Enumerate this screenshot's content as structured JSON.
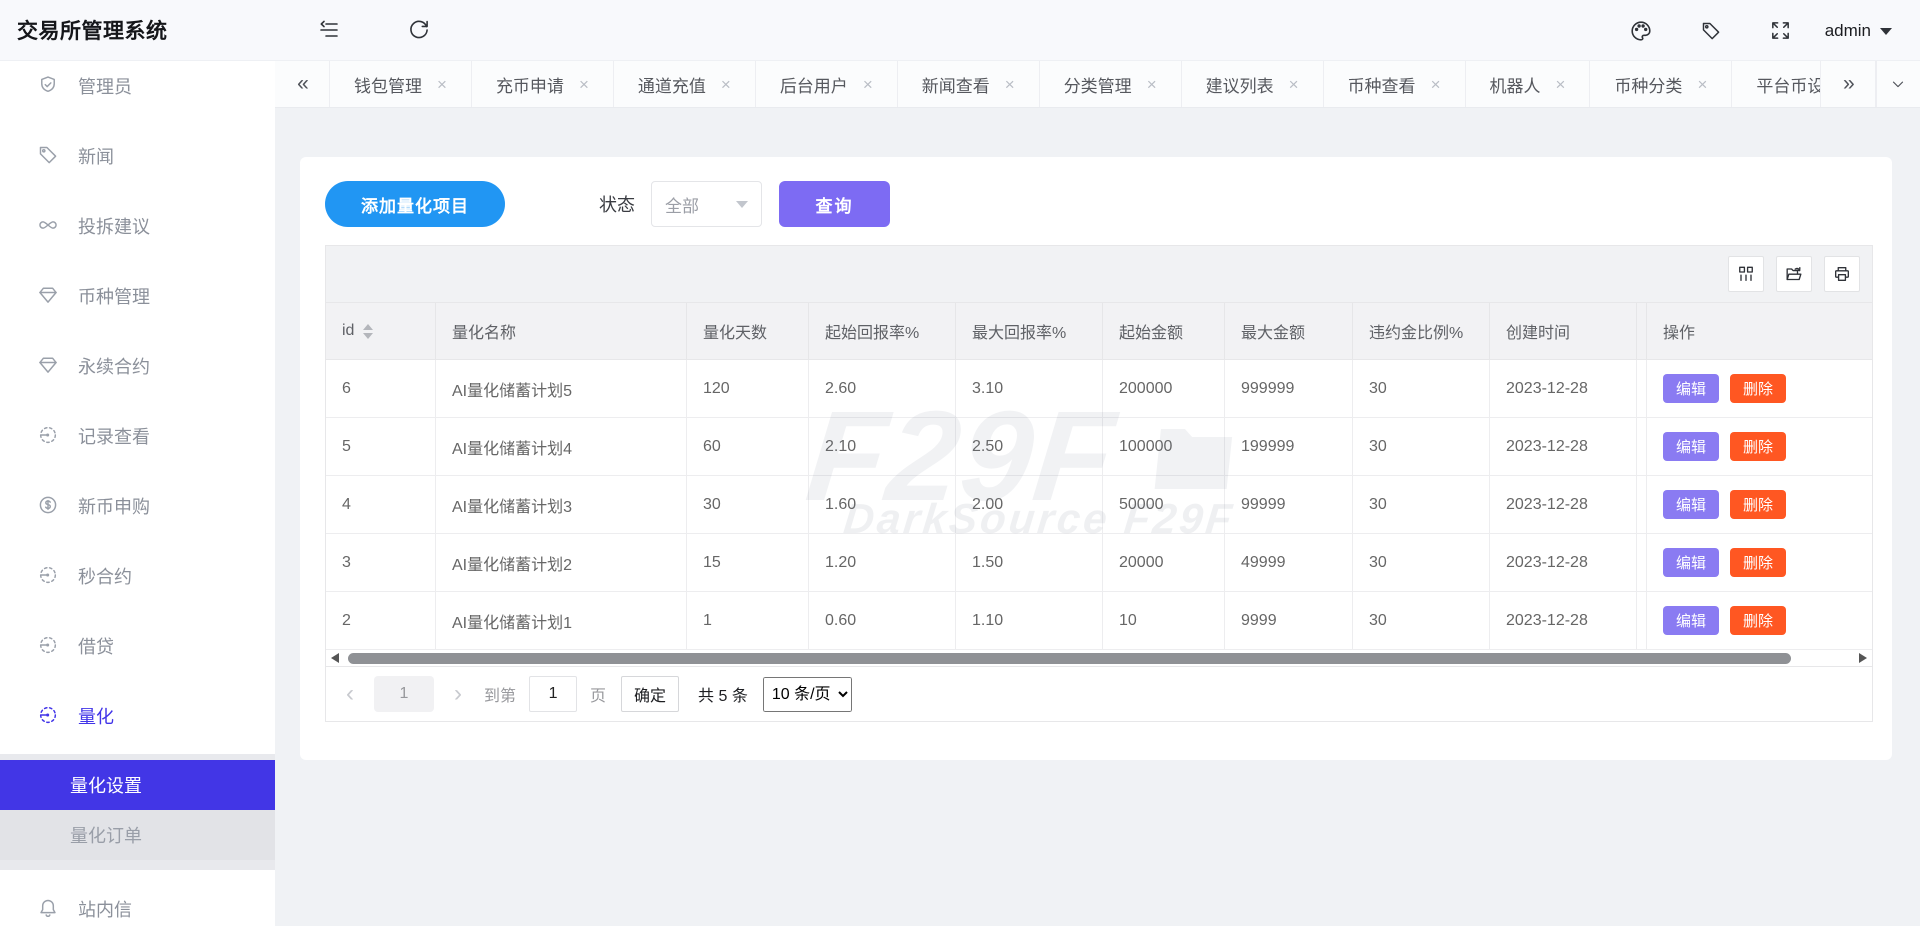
{
  "colors": {
    "accent_blue": "#2196f3",
    "accent_purple": "#7d6bf3",
    "edit_purple": "#8a7bf2",
    "delete_orange": "#ff5722",
    "active_indigo": "#4236e6",
    "page_background": "#f0f2f5"
  },
  "header": {
    "brand": "交易所管理系统",
    "user": "admin"
  },
  "sidebar": {
    "items": [
      {
        "label": "管理员",
        "icon": "shield-check"
      },
      {
        "label": "新闻",
        "icon": "tag"
      },
      {
        "label": "投拆建议",
        "icon": "infinity"
      },
      {
        "label": "币种管理",
        "icon": "diamond"
      },
      {
        "label": "永续合约",
        "icon": "diamond"
      },
      {
        "label": "记录查看",
        "icon": "gauge"
      },
      {
        "label": "新币申购",
        "icon": "dollar-circle"
      },
      {
        "label": "秒合约",
        "icon": "gauge"
      },
      {
        "label": "借贷",
        "icon": "gauge"
      },
      {
        "label": "量化",
        "icon": "gauge",
        "active": true
      },
      {
        "label": "站内信",
        "icon": "bell"
      }
    ],
    "submenu": [
      {
        "label": "量化设置",
        "active": true
      },
      {
        "label": "量化订单"
      }
    ]
  },
  "tabs": {
    "items": [
      {
        "label": "钱包管理"
      },
      {
        "label": "充币申请"
      },
      {
        "label": "通道充值"
      },
      {
        "label": "后台用户"
      },
      {
        "label": "新闻查看"
      },
      {
        "label": "分类管理"
      },
      {
        "label": "建议列表"
      },
      {
        "label": "币种查看"
      },
      {
        "label": "机器人"
      },
      {
        "label": "币种分类"
      },
      {
        "label": "平台币设",
        "truncated": true
      }
    ]
  },
  "glyphs": {
    "scroll_left": "«",
    "scroll_right": "»",
    "close": "×",
    "prev": "‹",
    "next": "›"
  },
  "filters": {
    "add_button": "添加量化项目",
    "status_label": "状态",
    "status_value": "全部",
    "search_button": "查询"
  },
  "table": {
    "columns": [
      "id",
      "量化名称",
      "量化天数",
      "起始回报率%",
      "最大回报率%",
      "起始金额",
      "最大金额",
      "违约金比例%",
      "创建时间",
      "操作"
    ],
    "rows": [
      [
        "6",
        "AI量化储蓄计划5",
        "120",
        "2.60",
        "3.10",
        "200000",
        "999999",
        "30",
        "2023-12-28"
      ],
      [
        "5",
        "AI量化储蓄计划4",
        "60",
        "2.10",
        "2.50",
        "100000",
        "199999",
        "30",
        "2023-12-28"
      ],
      [
        "4",
        "AI量化储蓄计划3",
        "30",
        "1.60",
        "2.00",
        "50000",
        "99999",
        "30",
        "2023-12-28"
      ],
      [
        "3",
        "AI量化储蓄计划2",
        "15",
        "1.20",
        "1.50",
        "20000",
        "49999",
        "30",
        "2023-12-28"
      ],
      [
        "2",
        "AI量化储蓄计划1",
        "1",
        "0.60",
        "1.10",
        "10",
        "9999",
        "30",
        "2023-12-28"
      ]
    ],
    "edit_label": "编辑",
    "delete_label": "删除"
  },
  "pagination": {
    "current": "1",
    "goto_prefix": "到第",
    "goto_value": "1",
    "goto_suffix": "页",
    "confirm": "确定",
    "total": "共 5 条",
    "page_size": "10 条/页"
  },
  "watermark": {
    "logo": "F29F",
    "text": "DarkSource F29F"
  }
}
